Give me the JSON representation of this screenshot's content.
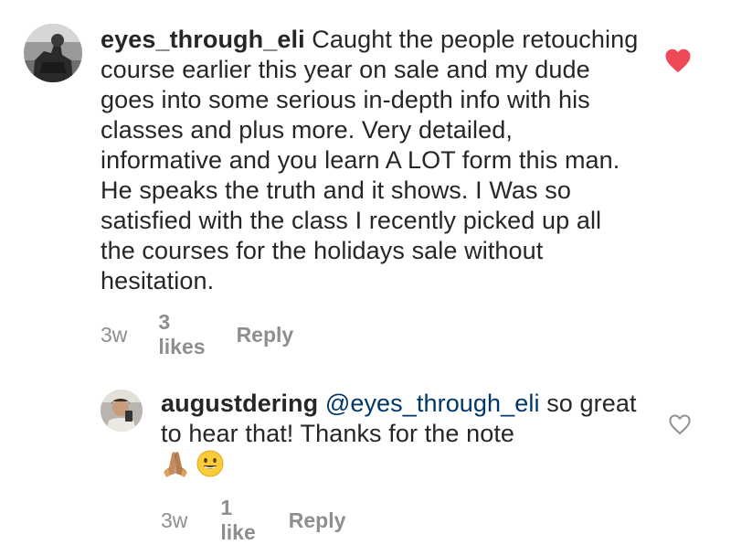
{
  "comments": [
    {
      "username": "eyes_through_eli",
      "text": " Caught the people retouching course earlier this year on sale and my dude goes into some serious in-depth info with his classes and plus more. Very detailed, informative and you learn A LOT form this man. He speaks the truth and it shows.  I Was so satisfied with the class I recently picked up all the courses for the holidays sale without hesitation.",
      "time": "3w",
      "likes": "3 likes",
      "reply_label": "Reply",
      "liked": true,
      "heart_icon": "heart-filled-icon",
      "heart_color": "#ed4956"
    },
    {
      "username": "augustdering",
      "mention": "@eyes_through_eli",
      "text": " so great to hear that! Thanks for the note ",
      "emojis": [
        "folded-hands-emoji",
        "smiling-face-emoji"
      ],
      "time": "3w",
      "likes": "1 like",
      "reply_label": "Reply",
      "liked": false,
      "heart_icon": "heart-outline-icon",
      "heart_color": "#8e8e8e"
    }
  ]
}
